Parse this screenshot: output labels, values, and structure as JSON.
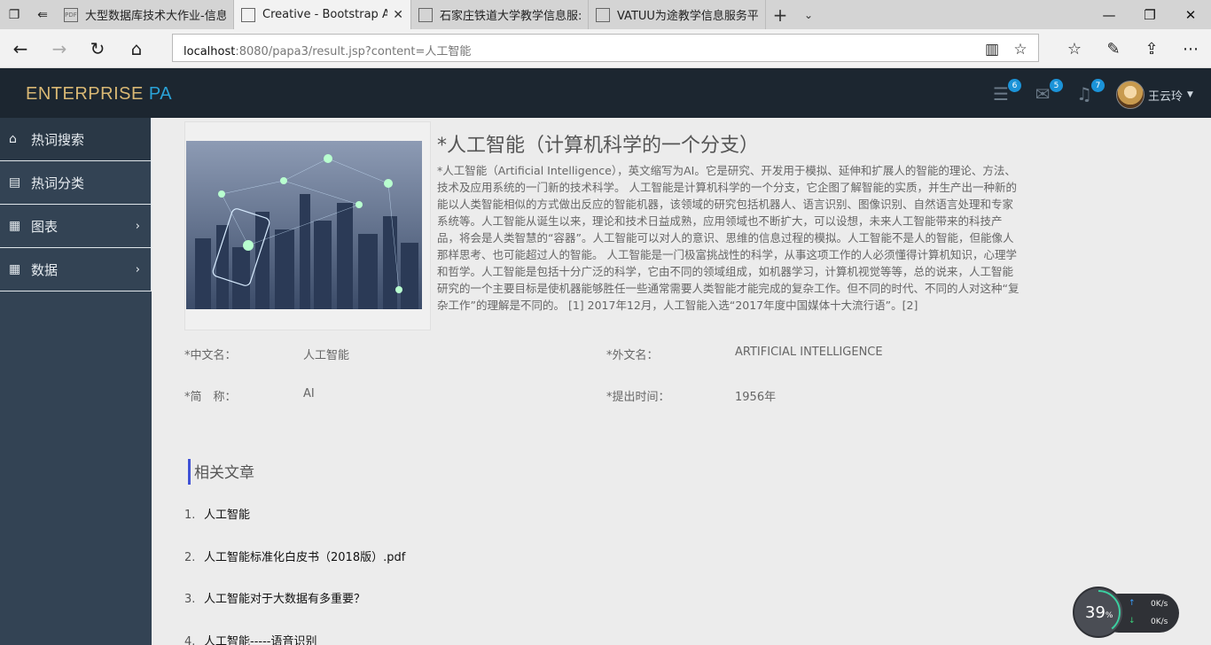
{
  "browser": {
    "tabs": [
      {
        "title": "大型数据库技术大作业-信息",
        "favicon": "PDF",
        "active": false
      },
      {
        "title": "Creative - Bootstrap Ad",
        "favicon": "",
        "active": true
      },
      {
        "title": "石家庄铁道大学教学信息服:",
        "favicon": "",
        "active": false
      },
      {
        "title": "VATUU为途教学信息服务平",
        "favicon": "",
        "active": false
      }
    ],
    "url_host": "localhost",
    "url_rest": ":8080/papa3/result.jsp?content=人工智能"
  },
  "header": {
    "brand_part1": "ENTERPRISE ",
    "brand_part2": "PA",
    "badges": {
      "tasks": "6",
      "messages": "5",
      "notifications": "7"
    },
    "user_name": "王云玲",
    "colors": {
      "brand_gold": "#d9b874",
      "brand_blue": "#2aa3d8",
      "badge": "#1b93d8",
      "header_bg": "#1c2630"
    }
  },
  "sidebar": {
    "items": [
      {
        "label": "热词搜索",
        "icon": "home-icon",
        "has_arrow": false
      },
      {
        "label": "热词分类",
        "icon": "document-icon",
        "has_arrow": false
      },
      {
        "label": "图表",
        "icon": "table-icon",
        "has_arrow": true
      },
      {
        "label": "数据",
        "icon": "table-icon",
        "has_arrow": true
      }
    ]
  },
  "article": {
    "title": "*人工智能（计算机科学的一个分支）",
    "description": "*人工智能（Artificial Intelligence），英文缩写为AI。它是研究、开发用于模拟、延伸和扩展人的智能的理论、方法、技术及应用系统的一门新的技术科学。 人工智能是计算机科学的一个分支，它企图了解智能的实质，并生产出一种新的能以人类智能相似的方式做出反应的智能机器，该领域的研究包括机器人、语言识别、图像识别、自然语言处理和专家系统等。人工智能从诞生以来，理论和技术日益成熟，应用领域也不断扩大，可以设想，未来人工智能带来的科技产品，将会是人类智慧的“容器”。人工智能可以对人的意识、思维的信息过程的模拟。人工智能不是人的智能，但能像人那样思考、也可能超过人的智能。 人工智能是一门极富挑战性的科学，从事这项工作的人必须懂得计算机知识，心理学和哲学。人工智能是包括十分广泛的科学，它由不同的领域组成，如机器学习，计算机视觉等等，总的说来，人工智能研究的一个主要目标是使机器能够胜任一些通常需要人类智能才能完成的复杂工作。但不同的时代、不同的人对这种“复杂工作”的理解是不同的。 [1] 2017年12月，人工智能入选“2017年度中国媒体十大流行语”。[2]",
    "facts": {
      "cn_name_label": "*中文名：",
      "cn_name_value": "人工智能",
      "foreign_name_label": "*外文名：",
      "foreign_name_value": "ARTIFICIAL INTELLIGENCE",
      "abbr_label": "*简　称：",
      "abbr_value": "AI",
      "proposed_label": "*提出时间：",
      "proposed_value": "1956年"
    }
  },
  "related": {
    "title": "相关文章",
    "items": [
      {
        "num": "1.",
        "text": "人工智能"
      },
      {
        "num": "2.",
        "text": "人工智能标准化白皮书（2018版）.pdf"
      },
      {
        "num": "3.",
        "text": "人工智能对于大数据有多重要？"
      },
      {
        "num": "4.",
        "text": "人工智能-----语音识别"
      }
    ]
  },
  "net_widget": {
    "percent": "39",
    "percent_unit": "%",
    "up_rate": "0",
    "down_rate": "0",
    "unit": "K/s"
  }
}
